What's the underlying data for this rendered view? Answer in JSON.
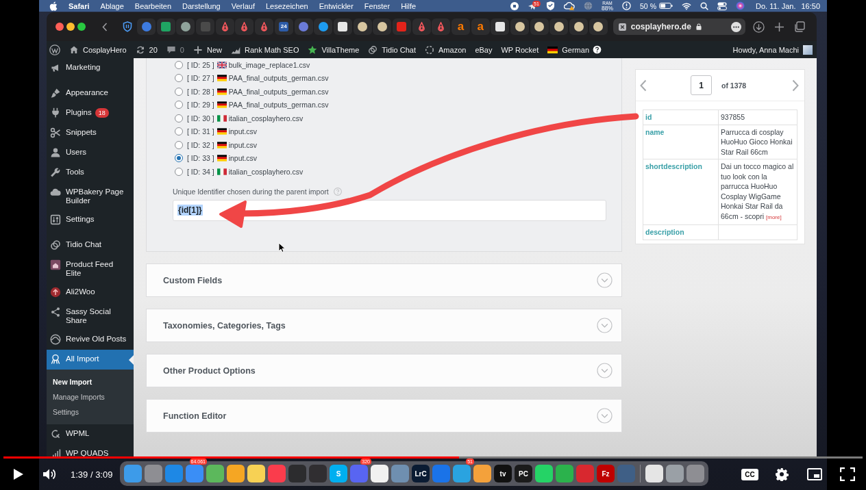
{
  "menubar": {
    "app": "Safari",
    "menus": [
      "Ablage",
      "Bearbeiten",
      "Darstellung",
      "Verlauf",
      "Lesezeichen",
      "Entwickler",
      "Fenster",
      "Hilfe"
    ],
    "status_badge": "51",
    "ram_label": "RAM",
    "ram_value": "88%",
    "battery": "50 %",
    "date": "Do. 11. Jan.",
    "time": "16:50"
  },
  "browser": {
    "tabs": [
      {
        "selected": false,
        "kind": "round",
        "color": "#3d7be0"
      },
      {
        "selected": false,
        "kind": "tile",
        "color": "#1fa463"
      },
      {
        "selected": false,
        "kind": "round",
        "color": "#8fa39b"
      },
      {
        "selected": false,
        "kind": "tile",
        "color": "#4a4a4a"
      },
      {
        "selected": false,
        "kind": "loop",
        "color": "#ff5a5f"
      },
      {
        "selected": false,
        "kind": "loop",
        "color": "#ff5a5f"
      },
      {
        "selected": false,
        "kind": "loop",
        "color": "#ff5a5f"
      },
      {
        "selected": false,
        "kind": "tile",
        "color": "#2d5ca8",
        "glyph": "24"
      },
      {
        "selected": false,
        "kind": "round",
        "color": "#6b7bd8"
      },
      {
        "selected": false,
        "kind": "round",
        "color": "#1d9bf0"
      },
      {
        "selected": false,
        "kind": "tile",
        "color": "#e6e6e6"
      },
      {
        "selected": false,
        "kind": "round",
        "color": "#d8c6a0"
      },
      {
        "selected": false,
        "kind": "round",
        "color": "#d8c6a0"
      },
      {
        "selected": false,
        "kind": "tile",
        "color": "#e2231a"
      },
      {
        "selected": false,
        "kind": "loop",
        "color": "#ff5a5f"
      },
      {
        "selected": false,
        "kind": "loop",
        "color": "#ff5a5f"
      },
      {
        "selected": false,
        "kind": "letter",
        "color": "#ff7a00",
        "glyph": "a"
      },
      {
        "selected": false,
        "kind": "letter",
        "color": "#ff7a00",
        "glyph": "a"
      },
      {
        "selected": false,
        "kind": "tile",
        "color": "#e6e6e6"
      },
      {
        "selected": false,
        "kind": "round",
        "color": "#d8c6a0"
      },
      {
        "selected": false,
        "kind": "round",
        "color": "#d8c6a0"
      },
      {
        "selected": false,
        "kind": "round",
        "color": "#d8c6a0"
      },
      {
        "selected": false,
        "kind": "round",
        "color": "#d8c6a0"
      },
      {
        "selected": false,
        "kind": "round",
        "color": "#d8c6a0"
      },
      {
        "selected": true,
        "label": "cosplayhero.de"
      }
    ]
  },
  "admin_bar": {
    "site": "CosplayHero",
    "updates": "20",
    "comments": "0",
    "new_label": "New",
    "links": [
      "Rank Math SEO",
      "VillaTheme",
      "Tidio Chat",
      "Amazon",
      "eBay",
      "WP Rocket"
    ],
    "language": "German",
    "greeting": "Howdy, Anna Machi"
  },
  "sidebar": {
    "groups": [
      {
        "items": [
          {
            "label": "Marketing",
            "selected": false
          }
        ]
      },
      {
        "items": [
          {
            "label": "Appearance",
            "selected": false
          },
          {
            "label": "Plugins",
            "selected": false,
            "badge": "18"
          },
          {
            "label": "Snippets",
            "selected": false
          },
          {
            "label": "Users",
            "selected": false
          },
          {
            "label": "Tools",
            "selected": false
          },
          {
            "label": "WPBakery Page Builder",
            "selected": false
          },
          {
            "label": "Settings",
            "selected": false
          }
        ]
      },
      {
        "items": [
          {
            "label": "Tidio Chat",
            "selected": false
          },
          {
            "label": "Product Feed Elite",
            "selected": false
          },
          {
            "label": "Ali2Woo",
            "selected": false
          },
          {
            "label": "Sassy Social Share",
            "selected": false
          },
          {
            "label": "Revive Old Posts",
            "selected": false
          },
          {
            "label": "All Import",
            "selected": true,
            "children": [
              {
                "label": "New Import",
                "selected": true
              },
              {
                "label": "Manage Imports",
                "selected": false
              },
              {
                "label": "Settings",
                "selected": false
              }
            ]
          },
          {
            "label": "WPML",
            "selected": false
          },
          {
            "label": "WP QUADS",
            "selected": false
          }
        ]
      }
    ]
  },
  "import_settings": {
    "files": [
      {
        "id": "[ ID: 25 ]",
        "file": "bulk_image_replace1.csv",
        "selected": false
      },
      {
        "id": "[ ID: 27 ]",
        "file": "PAA_final_outputs_german.csv",
        "selected": false
      },
      {
        "id": "[ ID: 28 ]",
        "file": "PAA_final_outputs_german.csv",
        "selected": false
      },
      {
        "id": "[ ID: 29 ]",
        "file": "PAA_final_outputs_german.csv",
        "selected": false
      },
      {
        "id": "[ ID: 30 ]",
        "file": "italian_cosplayhero.csv",
        "selected": false
      },
      {
        "id": "[ ID: 31 ]",
        "file": "input.csv",
        "selected": false
      },
      {
        "id": "[ ID: 32 ]",
        "file": "input.csv",
        "selected": false
      },
      {
        "id": "[ ID: 33 ]",
        "file": "input.csv",
        "selected": true
      },
      {
        "id": "[ ID: 34 ]",
        "file": "italian_cosplayhero.csv",
        "selected": false
      }
    ],
    "identifier_label": "Unique Identifier chosen during the parent import",
    "identifier_value": "{id[1]}",
    "value_highlighted": true
  },
  "sections": [
    {
      "title": "Custom Fields",
      "expanded": false
    },
    {
      "title": "Taxonomies, Categories, Tags",
      "expanded": false
    },
    {
      "title": "Other Product Options",
      "expanded": false
    },
    {
      "title": "Function Editor",
      "expanded": false
    }
  ],
  "preview": {
    "page": "1",
    "total": "of 1378",
    "rows": [
      {
        "key": "id",
        "value": "937855"
      },
      {
        "key": "name",
        "value": "Parrucca di cosplay HuoHuo Gioco Honkai Star Rail 66cm"
      },
      {
        "key": "shortdescription",
        "value": "Dai un tocco magico al tuo look con la parrucca HuoHuo Cosplay WigGame Honkai Star Rail da 66cm - scopri",
        "more": "[more]"
      },
      {
        "key": "description"
      }
    ]
  },
  "dock": {
    "apps": [
      {
        "color": "#3d9be9"
      },
      {
        "color": "#8e8e93"
      },
      {
        "color": "#1e88e5"
      },
      {
        "color": "#3a8ef6",
        "badge": "64.061"
      },
      {
        "color": "#5cb85c"
      },
      {
        "color": "#f5a623"
      },
      {
        "color": "#f7d154"
      },
      {
        "color": "#fa3c4c"
      },
      {
        "color": "#2c2c2e"
      },
      {
        "color": "#302e31"
      },
      {
        "color": "#00aff0",
        "glyph": "S"
      },
      {
        "color": "#5865f2",
        "badge": "320"
      },
      {
        "color": "#f1f1f1"
      },
      {
        "color": "#6f8fb0"
      },
      {
        "color": "#0a1b33",
        "glyph": "LrC"
      },
      {
        "color": "#1a73e8"
      },
      {
        "color": "#2aa3e0",
        "badge": "51"
      },
      {
        "color": "#f4a13b"
      },
      {
        "color": "#111111",
        "glyph": "tv"
      },
      {
        "color": "#1b1b1b",
        "glyph": "PC"
      },
      {
        "color": "#25d366"
      },
      {
        "color": "#2bb24c"
      },
      {
        "color": "#d8282f"
      },
      {
        "color": "#bf0000",
        "glyph": "Fz"
      },
      {
        "color": "#3f5f86"
      }
    ],
    "stacks": [
      {
        "color": "#e5e5e5"
      },
      {
        "color": "#9aa0a6"
      },
      {
        "color": "#8e8e93"
      }
    ]
  },
  "video_player": {
    "level": 0.53,
    "time": "1:39 / 3:09",
    "captions": "CC"
  }
}
